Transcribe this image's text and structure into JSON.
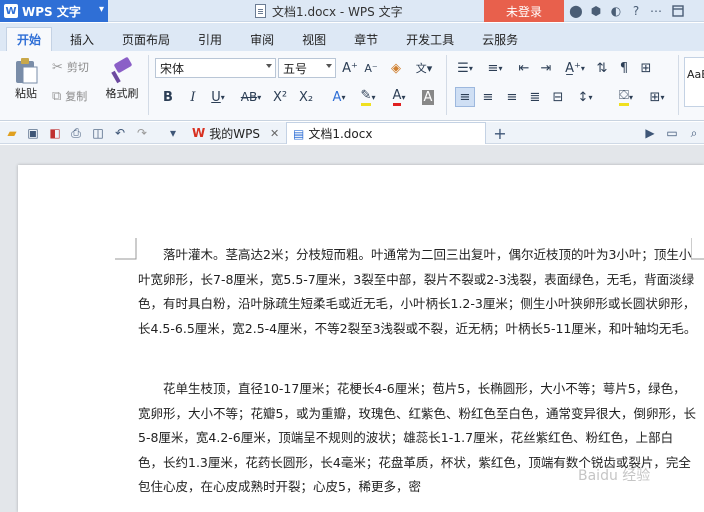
{
  "titlebar": {
    "app_name": "WPS 文字",
    "doc_title": "文档1.docx - WPS 文字",
    "login": "未登录"
  },
  "tabs": [
    "开始",
    "插入",
    "页面布局",
    "引用",
    "审阅",
    "视图",
    "章节",
    "开发工具",
    "云服务"
  ],
  "ribbon": {
    "paste": "粘贴",
    "cut": "剪切",
    "copy": "复制",
    "format_painter": "格式刷",
    "font_name": "宋体",
    "font_size": "五号",
    "style_preview": "AaB"
  },
  "doc_tabs": {
    "my_wps": "我的WPS",
    "current": "文档1.docx"
  },
  "document": {
    "para1": "落叶灌木。茎高达2米；分枝短而粗。叶通常为二回三出复叶，偶尔近枝顶的叶为3小叶；顶生小叶宽卵形，长7-8厘米，宽5.5-7厘米，3裂至中部，裂片不裂或2-3浅裂，表面绿色，无毛，背面淡绿色，有时具白粉，沿叶脉疏生短柔毛或近无毛，小叶柄长1.2-3厘米；侧生小叶狭卵形或长圆状卵形，长4.5-6.5厘米，宽2.5-4厘米，不等2裂至3浅裂或不裂，近无柄；叶柄长5-11厘米，和叶轴均无毛。",
    "para2": "花单生枝顶，直径10-17厘米；花梗长4-6厘米；苞片5，长椭圆形，大小不等；萼片5，绿色，宽卵形，大小不等；花瓣5，或为重瓣，玫瑰色、红紫色、粉红色至白色，通常变异很大，倒卵形，长5-8厘米，宽4.2-6厘米，顶端呈不规则的波状；雄蕊长1-1.7厘米，花丝紫红色、粉红色，上部白色，长约1.3厘米，花药长圆形，长4毫米；花盘革质，杯状，紫红色，顶端有数个锐齿或裂片，完全包住心皮，在心皮成熟时开裂；心皮5，稀更多，密",
    "watermark": "Baidu 经验"
  }
}
